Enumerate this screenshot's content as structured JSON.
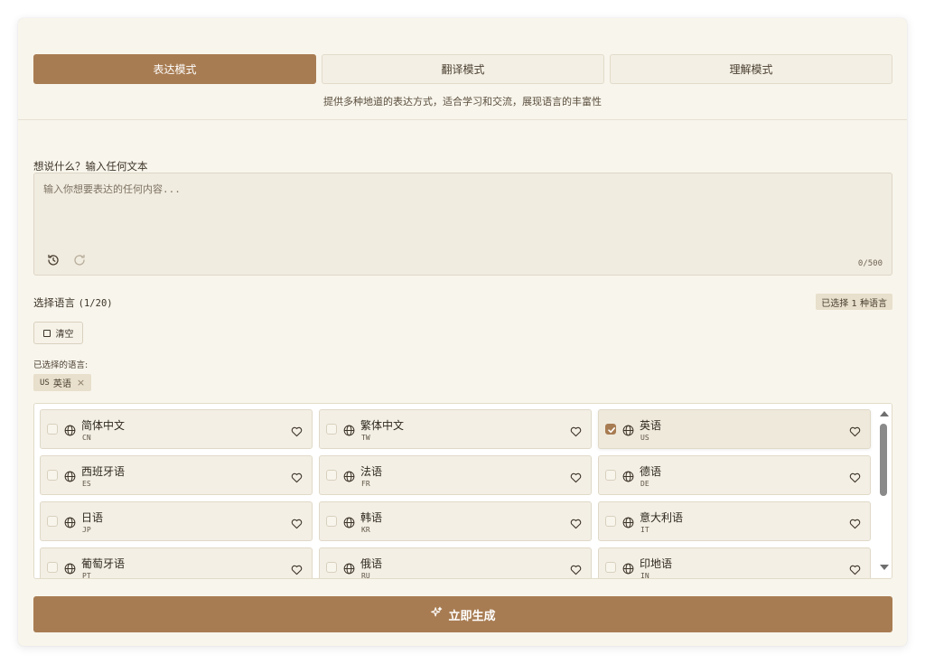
{
  "tabs": [
    {
      "label": "表达模式",
      "active": true
    },
    {
      "label": "翻译模式",
      "active": false
    },
    {
      "label": "理解模式",
      "active": false
    }
  ],
  "tab_description": "提供多种地道的表达方式，适合学习和交流，展现语言的丰富性",
  "input": {
    "label": "想说什么？输入任何文本",
    "placeholder": "输入你想要表达的任何内容...",
    "value": "",
    "char_count": "0/500",
    "undo_icon": "history-icon",
    "redo_icon": "redo-icon"
  },
  "languages": {
    "title": "选择语言",
    "count": "(1/20)",
    "selected_badge": "已选择 1 种语言",
    "clear_label": "清空",
    "selected_label": "已选择的语言:",
    "selected_chips": [
      {
        "code": "US",
        "name": "英语"
      }
    ],
    "items": [
      {
        "name": "简体中文",
        "code": "CN",
        "checked": false
      },
      {
        "name": "繁体中文",
        "code": "TW",
        "checked": false
      },
      {
        "name": "英语",
        "code": "US",
        "checked": true
      },
      {
        "name": "西班牙语",
        "code": "ES",
        "checked": false
      },
      {
        "name": "法语",
        "code": "FR",
        "checked": false
      },
      {
        "name": "德语",
        "code": "DE",
        "checked": false
      },
      {
        "name": "日语",
        "code": "JP",
        "checked": false
      },
      {
        "name": "韩语",
        "code": "KR",
        "checked": false
      },
      {
        "name": "意大利语",
        "code": "IT",
        "checked": false
      },
      {
        "name": "葡萄牙语",
        "code": "PT",
        "checked": false
      },
      {
        "name": "俄语",
        "code": "RU",
        "checked": false
      },
      {
        "name": "印地语",
        "code": "IN",
        "checked": false
      }
    ]
  },
  "generate_button": {
    "label": "立即生成",
    "icon": "sparkles-icon"
  },
  "colors": {
    "accent": "#a87c52",
    "card_background": "#f8f5ec",
    "item_background": "#f3efe5"
  }
}
